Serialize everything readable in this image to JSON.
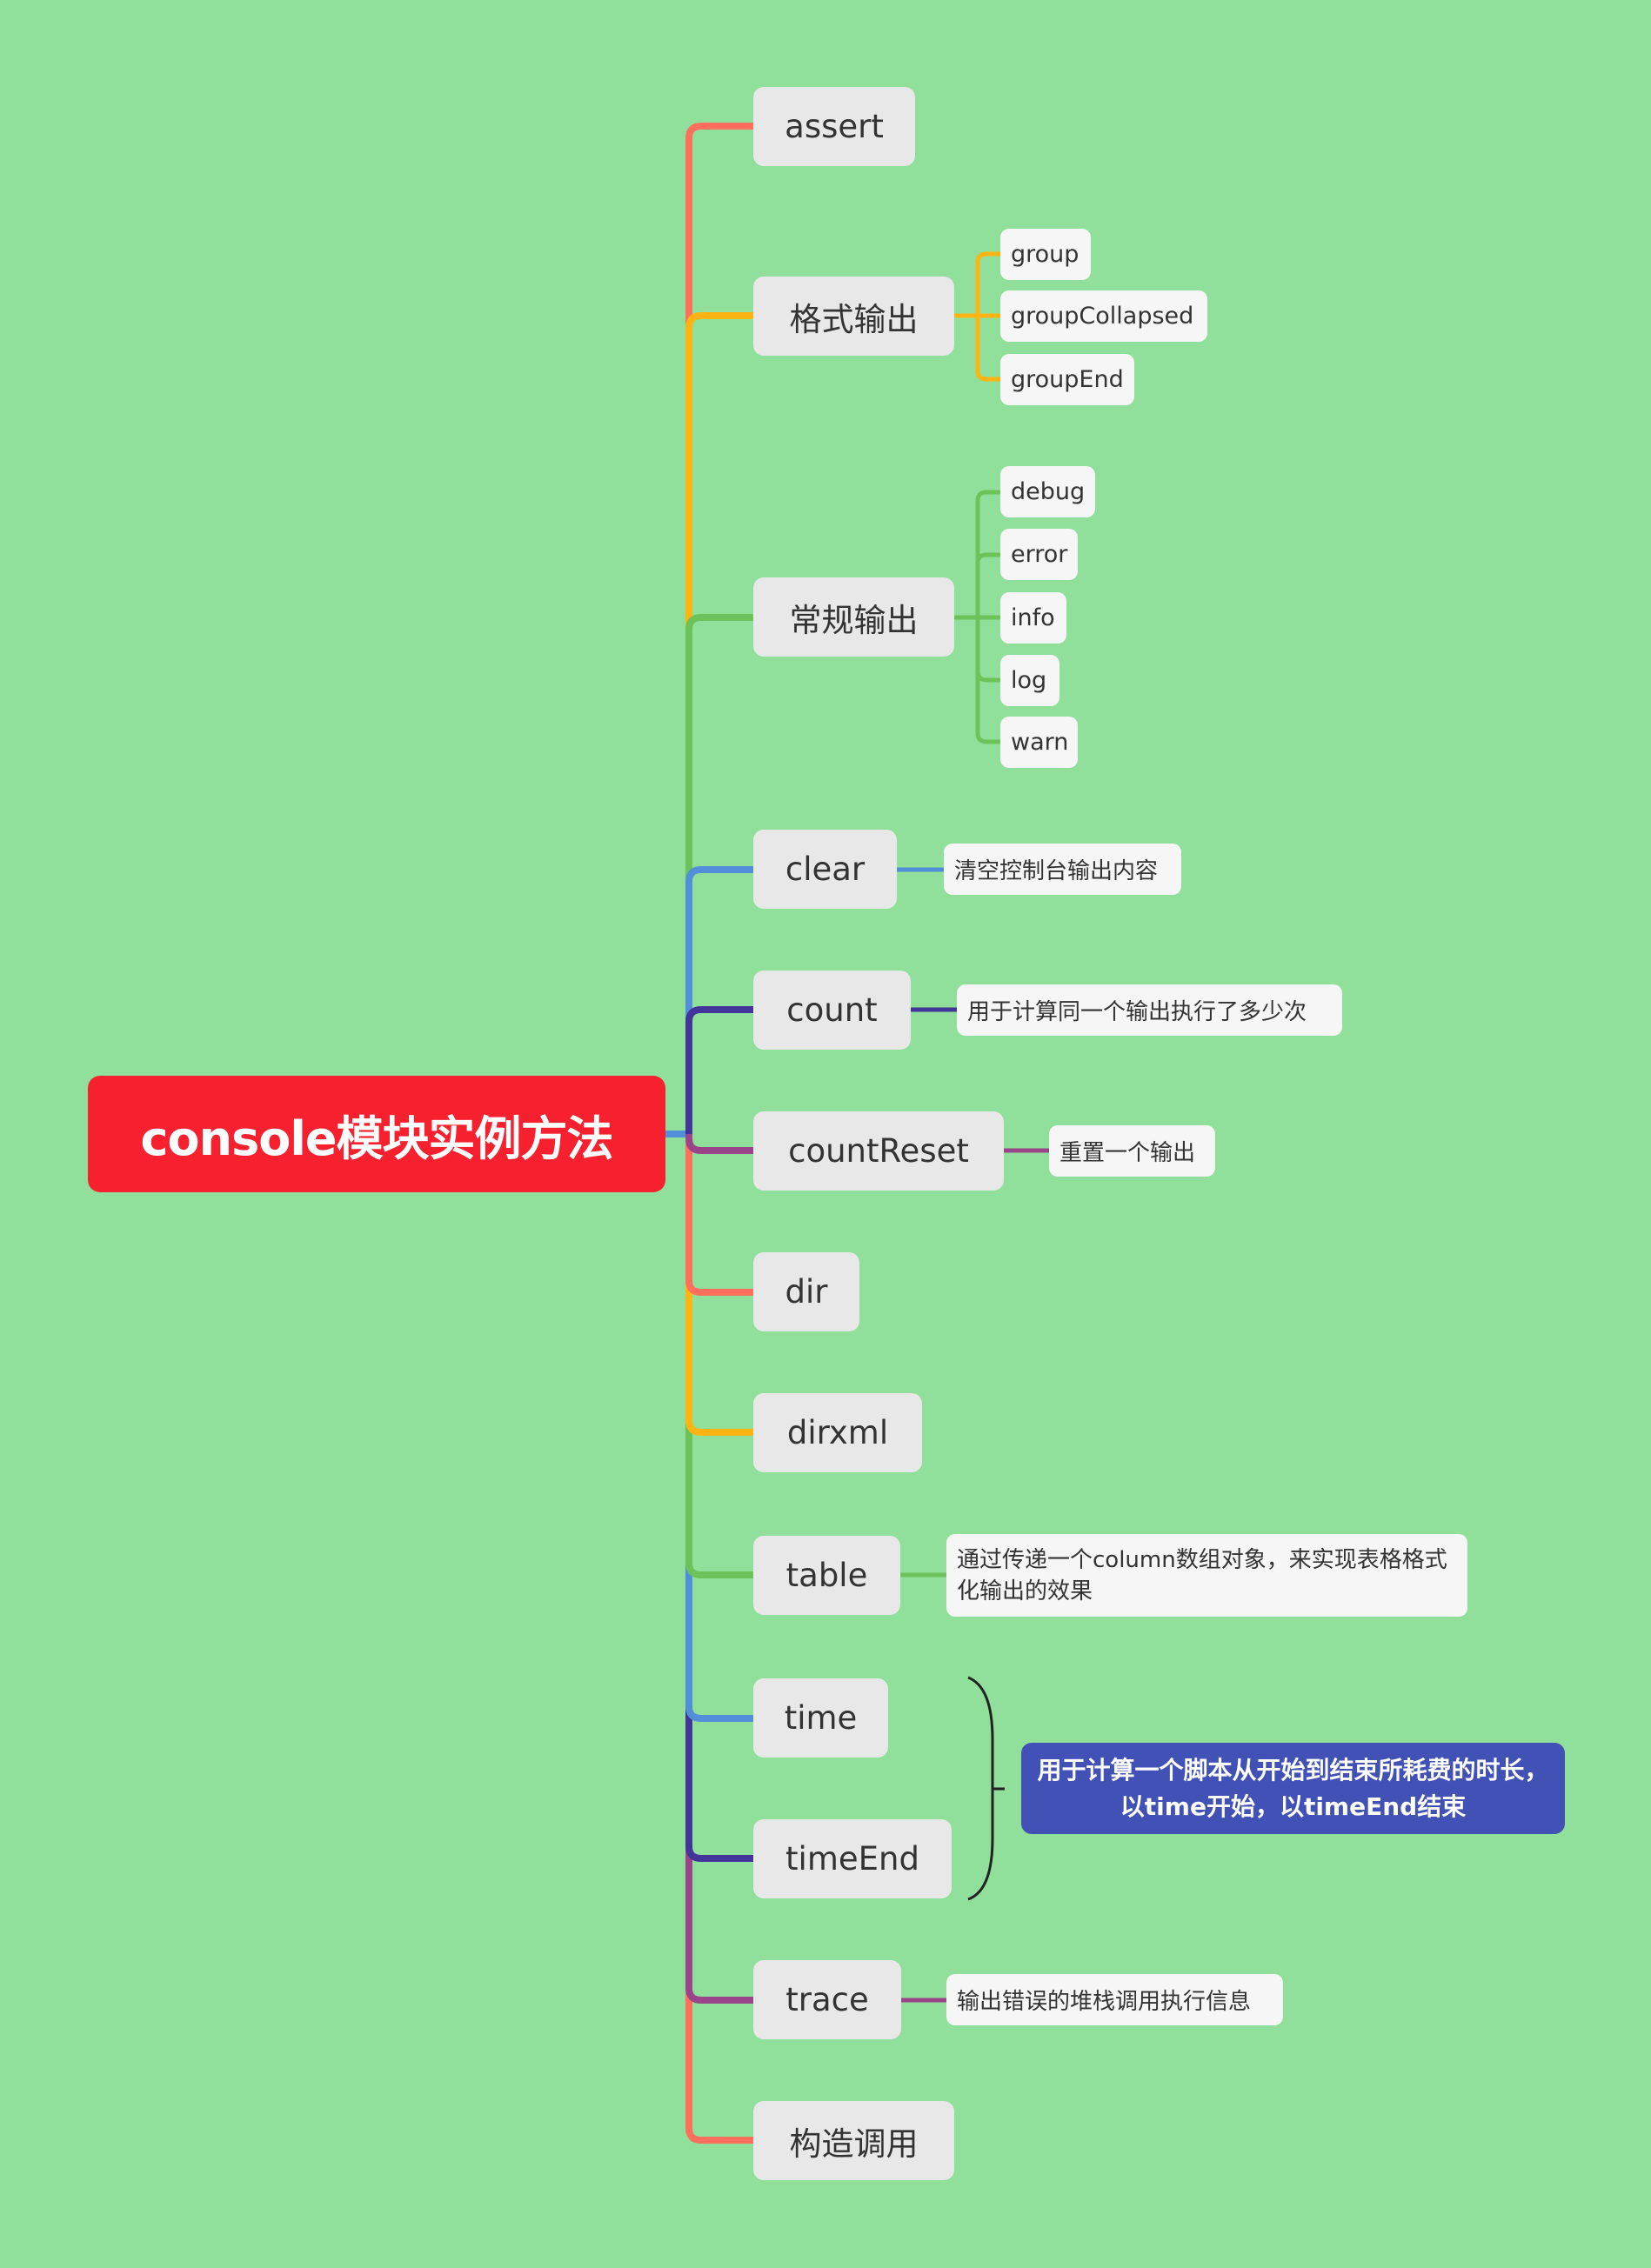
{
  "root": {
    "label": "console模块实例方法",
    "color": "#f7202e"
  },
  "branch_colors": {
    "red": "#ff6f5e",
    "yellow": "#ffb414",
    "green": "#6cc35a",
    "blue": "#528fd9",
    "navy": "#43349a",
    "purple": "#9a4589"
  },
  "methods": [
    {
      "label": "assert",
      "branch": "red"
    },
    {
      "label": "格式输出",
      "branch": "yellow",
      "children": [
        "group",
        "groupCollapsed",
        "groupEnd"
      ]
    },
    {
      "label": "常规输出",
      "branch": "green",
      "children": [
        "debug",
        "error",
        "info",
        "log",
        "warn"
      ]
    },
    {
      "label": "clear",
      "branch": "blue",
      "note": "清空控制台输出内容"
    },
    {
      "label": "count",
      "branch": "navy",
      "note": "用于计算同一个输出执行了多少次"
    },
    {
      "label": "countReset",
      "branch": "purple",
      "note": "重置一个输出"
    },
    {
      "label": "dir",
      "branch": "red"
    },
    {
      "label": "dirxml",
      "branch": "yellow"
    },
    {
      "label": "table",
      "branch": "green",
      "note": "通过传递一个column数组对象，来实现表格格式化输出的效果"
    },
    {
      "label": "time",
      "branch": "blue"
    },
    {
      "label": "timeEnd",
      "branch": "navy"
    },
    {
      "label": "trace",
      "branch": "purple",
      "note": "输出错误的堆栈调用执行信息"
    },
    {
      "label": "构造调用",
      "branch": "red"
    }
  ],
  "summary": {
    "label": "用于计算一个脚本从开始到结束所耗费的时长，以time开始，以timeEnd结束",
    "covers": [
      "time",
      "timeEnd"
    ],
    "color": "#4151b5"
  }
}
